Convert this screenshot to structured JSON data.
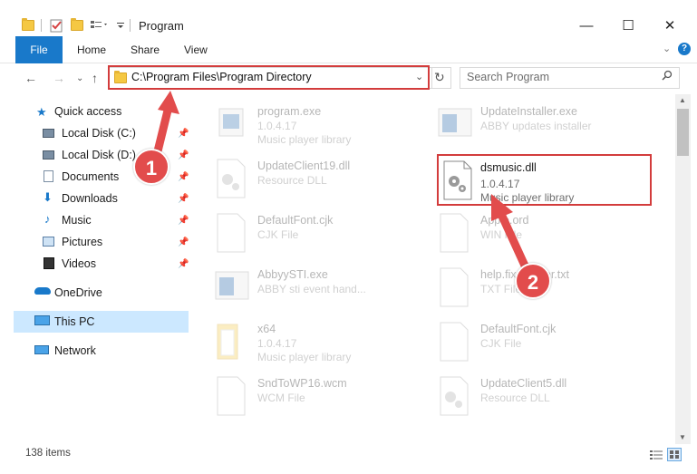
{
  "window": {
    "title": "Program",
    "minimize": "—",
    "maximize": "☐",
    "close": "✕"
  },
  "ribbon": {
    "tabs": [
      "File",
      "Home",
      "Share",
      "View"
    ],
    "help": "?"
  },
  "address": {
    "path": "C:\\Program Files\\Program Directory",
    "search_placeholder": "Search Program"
  },
  "sidebar": {
    "quick_access": "Quick access",
    "items": [
      "Local Disk (C:)",
      "Local Disk (D:)",
      "Documents",
      "Downloads",
      "Music",
      "Pictures",
      "Videos"
    ],
    "onedrive": "OneDrive",
    "this_pc": "This PC",
    "network": "Network"
  },
  "files": [
    {
      "name": "program.exe",
      "line2": "1.0.4.17",
      "line3": "Music player library"
    },
    {
      "name": "UpdateInstaller.exe",
      "line2": "ABBY updates installer",
      "line3": ""
    },
    {
      "name": "UpdateClient19.dll",
      "line2": "Resource DLL",
      "line3": ""
    },
    {
      "name": "dsmusic.dll",
      "line2": "1.0.4.17",
      "line3": "Music player library"
    },
    {
      "name": "DefaultFont.cjk",
      "line2": "CJK File",
      "line3": ""
    },
    {
      "name": "Apple.ord",
      "line2": "WIN File",
      "line3": ""
    },
    {
      "name": "AbbyySTI.exe",
      "line2": "ABBY sti event hand...",
      "line3": ""
    },
    {
      "name": "help.fix.header.txt",
      "line2": "TXT File",
      "line3": ""
    },
    {
      "name": "x64",
      "line2": "1.0.4.17",
      "line3": "Music player library"
    },
    {
      "name": "DefaultFont.cjk",
      "line2": "CJK File",
      "line3": ""
    },
    {
      "name": "SndToWP16.wcm",
      "line2": "WCM File",
      "line3": ""
    },
    {
      "name": "UpdateClient5.dll",
      "line2": "Resource DLL",
      "line3": ""
    }
  ],
  "status": {
    "item_count": "138 items"
  },
  "markers": [
    "1",
    "2"
  ],
  "colors": {
    "accent": "#1979ca",
    "highlight": "#d33c3c",
    "marker": "#e24c4c",
    "selection": "#cce8ff"
  }
}
